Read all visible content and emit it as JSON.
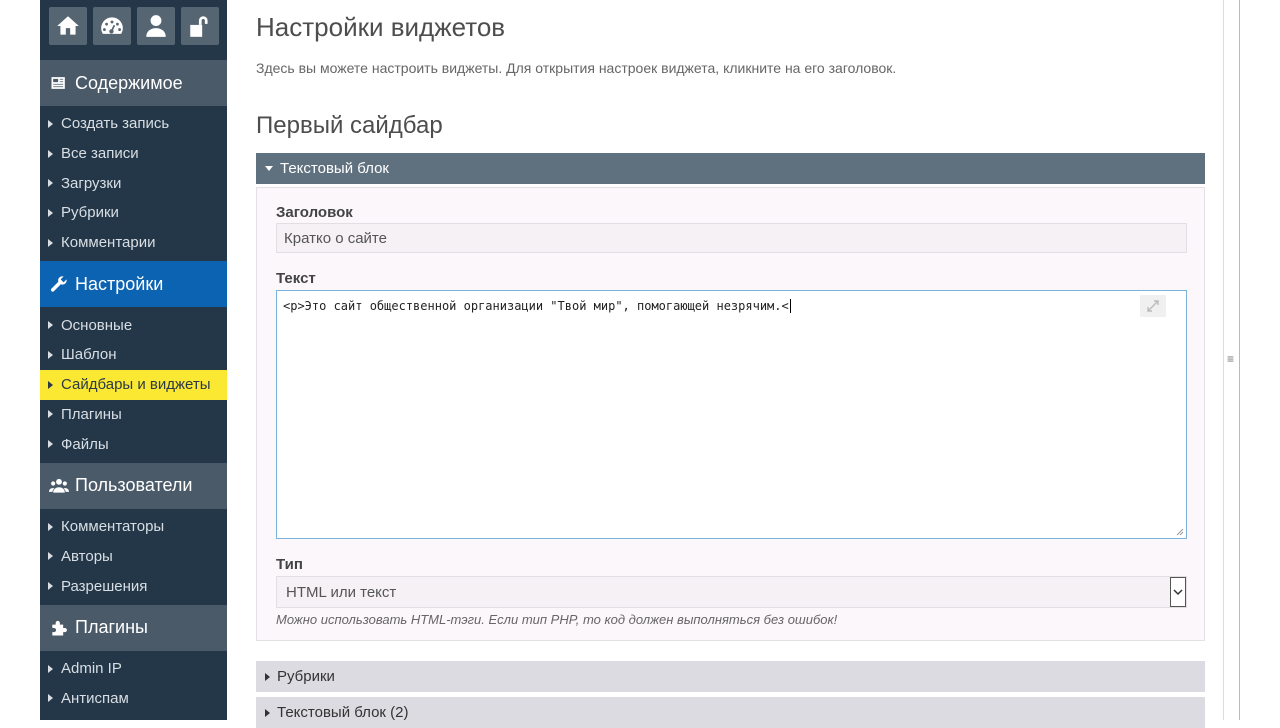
{
  "sidebar": {
    "sections": [
      {
        "title": "Содержимое",
        "icon": "newspaper-icon",
        "items": [
          "Создать запись",
          "Все записи",
          "Загрузки",
          "Рубрики",
          "Комментарии"
        ]
      },
      {
        "title": "Настройки",
        "icon": "wrench-icon",
        "items": [
          "Основные",
          "Шаблон",
          "Сайдбары и виджеты",
          "Плагины",
          "Файлы"
        ]
      },
      {
        "title": "Пользователи",
        "icon": "users-icon",
        "items": [
          "Комментаторы",
          "Авторы",
          "Разрешения"
        ]
      },
      {
        "title": "Плагины",
        "icon": "puzzle-icon",
        "items": [
          "Admin IP",
          "Антиспам"
        ]
      }
    ],
    "active_section": "Настройки",
    "current_item": "Сайдбары и виджеты"
  },
  "main": {
    "title": "Настройки виджетов",
    "description": "Здесь вы можете настроить виджеты. Для открытия настроек виджета, кликните на его заголовок.",
    "sidebar_title": "Первый сайдбар",
    "widget": {
      "header": "Текстовый блок",
      "title_label": "Заголовок",
      "title_value": "Кратко о сайте",
      "text_label": "Текст",
      "text_value": "<p>Это сайт общественной организации \"Твой мир\", помогающей незрячим.<",
      "type_label": "Тип",
      "type_value": "HTML или текст",
      "type_hint": "Можно использовать HTML-тэги. Если тип PHP, то код должен выполняться без ошибок!"
    },
    "collapsed_widgets": [
      "Рубрики",
      "Текстовый блок (2)"
    ]
  }
}
